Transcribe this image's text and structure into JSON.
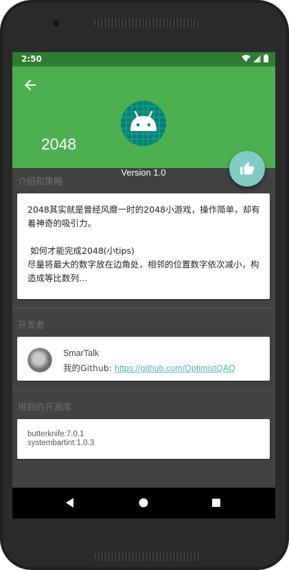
{
  "status_bar": {
    "time": "2:50",
    "icons": [
      "wifi-icon",
      "signal-icon",
      "battery-icon"
    ]
  },
  "app_bar": {
    "title": "2048",
    "version": "Version 1.0",
    "back_icon": "arrow-back-icon",
    "logo_icon": "android-logo-icon",
    "fab_icon": "thumb-up-icon",
    "colors": {
      "primary": "#4caf50",
      "primary_dark": "#2e7d32",
      "accent": "#80cbc4",
      "logo_bg": "#008577"
    }
  },
  "sections": {
    "intro": {
      "title": "介绍和策略",
      "paragraph1": "2048其实就是曾经风靡一时的2048小游戏，操作简单，却有着神奇的吸引力。",
      "paragraph2": " 如何才能完成2048(小tips)\n尽量将最大的数字放在边角处，相邻的位置数字依次减小，构造成等比数列..."
    },
    "developer": {
      "title": "开发者",
      "name": "SmarTalk",
      "github_label": "我的Github: ",
      "github_link": "https://github.com/OptimistQAQ"
    },
    "libraries": {
      "title": "用到的开源库",
      "items": [
        "butterknife:7.0.1",
        "systembartint:1.0.3"
      ]
    }
  },
  "nav_bar": {
    "buttons": [
      "back-triangle-icon",
      "home-circle-icon",
      "recents-square-icon"
    ]
  }
}
